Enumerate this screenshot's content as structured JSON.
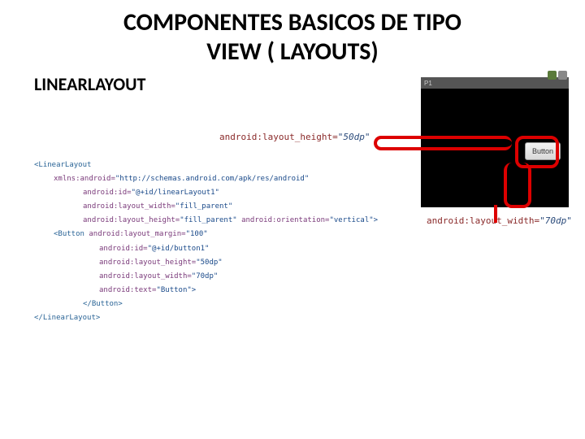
{
  "title_line1": "COMPONENTES  BASICOS DE TIPO",
  "title_line2": "VIEW ( LAYOUTS)",
  "subtitle": "LINEARLAYOUT",
  "height_label": "android:layout_height=",
  "height_val": "\"50dp\"",
  "width_label": "android:layout_width=",
  "width_val": "\"70dp\"",
  "phone": {
    "title": "P1",
    "button": "Button"
  },
  "code": {
    "l1a": "<LinearLayout",
    "l1b": "xmlns:android=",
    "l1c": "\"http://schemas.android.com/apk/res/android\"",
    "l2a": "android:id=",
    "l2b": "\"@+id/linearLayout1\"",
    "l3a": "android:layout_width=",
    "l3b": "\"fill_parent\"",
    "l4a": "android:layout_height=",
    "l4b": "\"fill_parent\"",
    "l4c": " android:orientation=",
    "l4d": "\"vertical\">",
    "l5a": "<Button ",
    "l5b": "android:layout_margin=",
    "l5c": "\"100\"",
    "l6a": "android:id=",
    "l6b": "\"@+id/button1\"",
    "l7a": "android:layout_height=",
    "l7b": "\"50dp\"",
    "l8a": "android:layout_width=",
    "l8b": "\"70dp\"",
    "l9a": "android:text=",
    "l9b": "\"Button\">",
    "l10": "</Button>",
    "l11": "</LinearLayout>"
  }
}
